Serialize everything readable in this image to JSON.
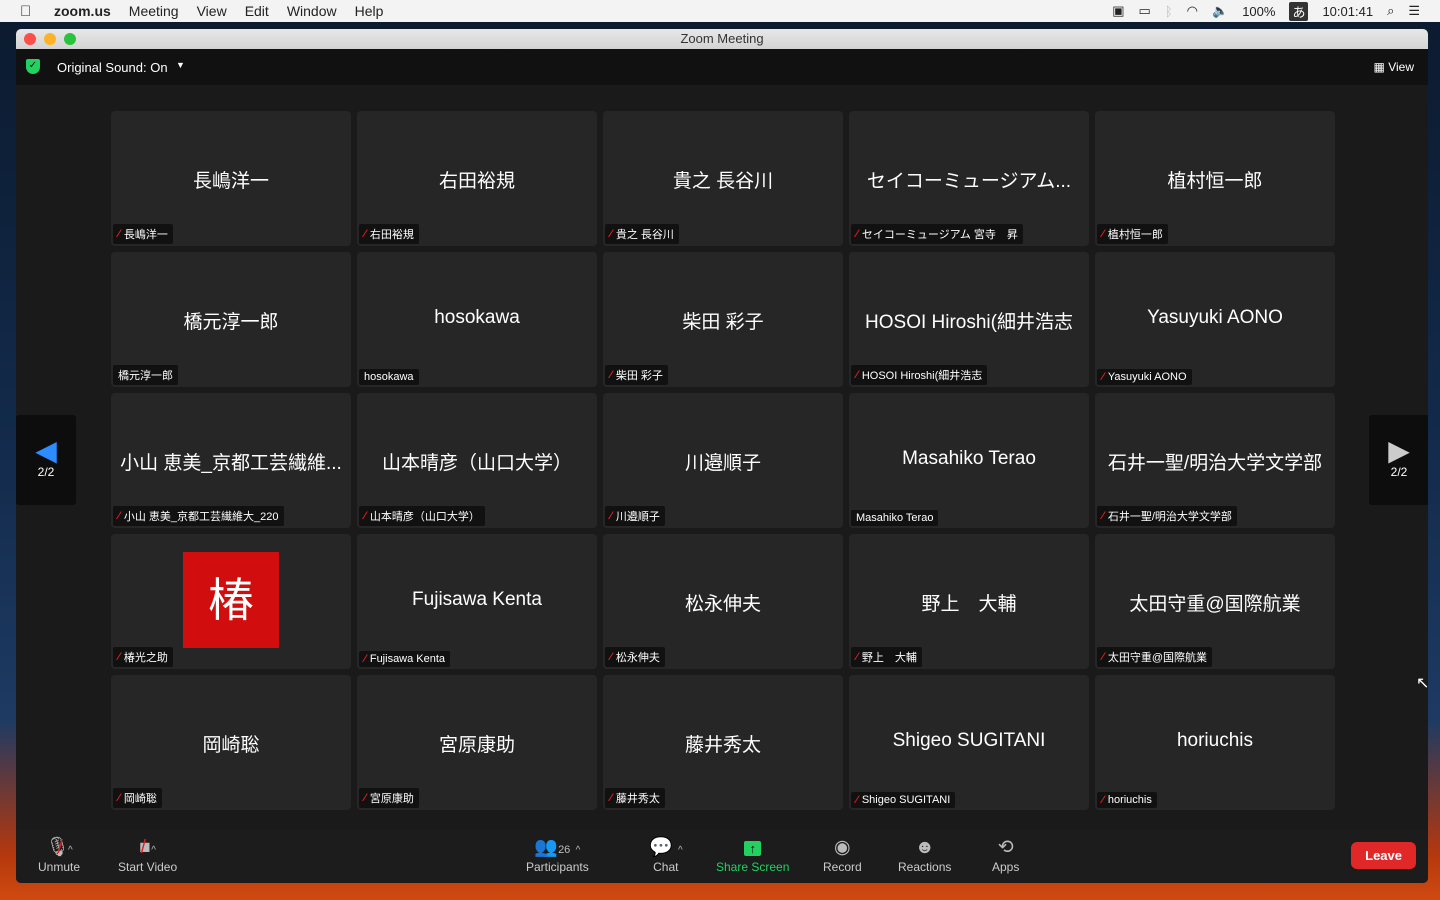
{
  "menubar": {
    "app": "zoom.us",
    "items": [
      "Meeting",
      "View",
      "Edit",
      "Window",
      "Help"
    ],
    "battery": "100%",
    "clock": "10:01:41",
    "ime": "あ"
  },
  "window": {
    "title": "Zoom Meeting",
    "original_sound": "Original Sound: On",
    "view_label": "View"
  },
  "pagination": {
    "left": "2/2",
    "right": "2/2"
  },
  "tiles": [
    {
      "name": "長嶋洋一",
      "label": "長嶋洋一",
      "muted": true
    },
    {
      "name": "右田裕規",
      "label": "右田裕規",
      "muted": true
    },
    {
      "name": "貴之 長谷川",
      "label": "貴之 長谷川",
      "muted": true
    },
    {
      "name": "セイコーミュージアム...",
      "label": "セイコーミュージアム 宮寺　昇",
      "muted": true
    },
    {
      "name": "植村恒一郎",
      "label": "植村恒一郎",
      "muted": true
    },
    {
      "name": "橋元淳一郎",
      "label": "橋元淳一郎",
      "muted": false
    },
    {
      "name": "hosokawa",
      "label": "hosokawa",
      "muted": false
    },
    {
      "name": "柴田 彩子",
      "label": "柴田 彩子",
      "muted": true
    },
    {
      "name": "HOSOI Hiroshi(細井浩志",
      "label": "HOSOI Hiroshi(細井浩志",
      "muted": true
    },
    {
      "name": "Yasuyuki AONO",
      "label": "Yasuyuki AONO",
      "muted": true
    },
    {
      "name": "小山 恵美_京都工芸繊維...",
      "label": "小山 恵美_京都工芸繊維大_220",
      "muted": true
    },
    {
      "name": "山本晴彦（山口大学）",
      "label": "山本晴彦（山口大学）",
      "muted": true
    },
    {
      "name": "川邉順子",
      "label": "川邉順子",
      "muted": true
    },
    {
      "name": "Masahiko Terao",
      "label": "Masahiko Terao",
      "muted": false
    },
    {
      "name": "石井一聖/明治大学文学部",
      "label": "石井一聖/明治大学文学部",
      "muted": true
    },
    {
      "name": "",
      "avatar": "椿",
      "label": "椿光之助",
      "muted": true
    },
    {
      "name": "Fujisawa Kenta",
      "label": "Fujisawa Kenta",
      "muted": true
    },
    {
      "name": "松永伸夫",
      "label": "松永伸夫",
      "muted": true
    },
    {
      "name": "野上　大輔",
      "label": "野上　大輔",
      "muted": true
    },
    {
      "name": "太田守重@国際航業",
      "label": "太田守重@国際航業",
      "muted": true
    },
    {
      "name": "岡崎聡",
      "label": "岡崎聡",
      "muted": true
    },
    {
      "name": "宮原康助",
      "label": "宮原康助",
      "muted": true
    },
    {
      "name": "藤井秀太",
      "label": "藤井秀太",
      "muted": true
    },
    {
      "name": "Shigeo SUGITANI",
      "label": "Shigeo SUGITANI",
      "muted": true
    },
    {
      "name": "horiuchis",
      "label": "horiuchis",
      "muted": true
    }
  ],
  "toolbar": {
    "unmute": "Unmute",
    "start_video": "Start Video",
    "participants": "Participants",
    "participant_count": "26",
    "chat": "Chat",
    "share": "Share Screen",
    "record": "Record",
    "reactions": "Reactions",
    "apps": "Apps",
    "leave": "Leave"
  },
  "colors": {
    "accent_green": "#23d160",
    "leave_red": "#e02828",
    "nav_blue": "#2d8cff"
  }
}
